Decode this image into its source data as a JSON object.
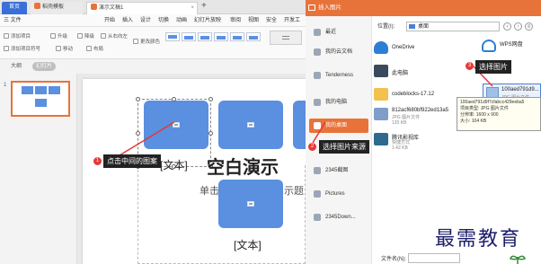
{
  "tabs": [
    {
      "label": "首页"
    },
    {
      "label": "稻壳模板"
    },
    {
      "label": "演示文稿1"
    }
  ],
  "menu": [
    "三 文件",
    "开始",
    "插入",
    "设计",
    "切换",
    "动画",
    "幻灯片放映",
    "审阅",
    "视图",
    "安全",
    "开发工"
  ],
  "ribbon": {
    "row1": [
      "添加项目",
      "升级",
      "降级",
      "从右向左",
      "更改颜色"
    ],
    "row2": [
      "添加项目符号",
      "移动",
      "布局"
    ]
  },
  "pane_tabs": [
    "大纲",
    "幻灯片"
  ],
  "slide_number": "1",
  "slide": {
    "text_label_1": "[文本]",
    "text_label_2": "[文本]",
    "title_overlap": "空白演示",
    "subtitle_left": "单击",
    "subtitle_right": "示题"
  },
  "annotations": [
    {
      "num": "1",
      "text": "点击中间的图案"
    },
    {
      "num": "2",
      "text": "选择图片来源"
    },
    {
      "num": "3",
      "text": "选择图片"
    }
  ],
  "dialog": {
    "title": "插入图片",
    "location_label": "位置(I):",
    "location_value": "桌面",
    "sidebar": [
      {
        "label": "最近",
        "active": false
      },
      {
        "label": "我的云文档",
        "active": false
      },
      {
        "label": "Tenderness",
        "active": false
      },
      {
        "label": "我的电脑",
        "active": false
      },
      {
        "label": "我的桌面",
        "active": true
      },
      {
        "label": "2345截图",
        "active": false
      },
      {
        "label": "Pictures",
        "active": false
      },
      {
        "label": "2345Down...",
        "active": false
      }
    ],
    "files": [
      {
        "name": "OneDrive",
        "sub": "",
        "icon": "cloud-icon",
        "color": "#2d7fd6"
      },
      {
        "name": "WPS网盘",
        "sub": "",
        "icon": "wps-cloud-icon",
        "color": "#2d7fd6"
      },
      {
        "name": "此电脑",
        "sub": "",
        "icon": "computer-icon",
        "color": "#3a4a5e"
      },
      {
        "name": "codeblocks-17.12",
        "sub": "",
        "icon": "folder-icon",
        "color": "#f2c14e"
      },
      {
        "name": "812acf680bf922ed13a5",
        "sub": "JPG 图片文件\n120 KB",
        "icon": "image-file-icon",
        "color": "#7e9dc8"
      },
      {
        "name": "腾讯影视库",
        "sub": "快捷方式\n1.42 KB",
        "icon": "shortcut-icon",
        "color": "#2c6b8f"
      }
    ],
    "selected_file": {
      "name": "100aed791d9...",
      "sub": "JPG 图片文件"
    },
    "tooltip": [
      "100aed791d9f7cfabcc429eeba5",
      "项目类型: JPG 图片文件",
      "分辨率: 1600 x 900",
      "大小: 104 KB"
    ],
    "filename_label": "文件名(N):"
  },
  "watermark": "最需教育",
  "colors": {
    "accent": "#e8733a",
    "shape_blue": "#5b8fe0",
    "badge_red": "#e53935",
    "note_bg": "#222222"
  }
}
